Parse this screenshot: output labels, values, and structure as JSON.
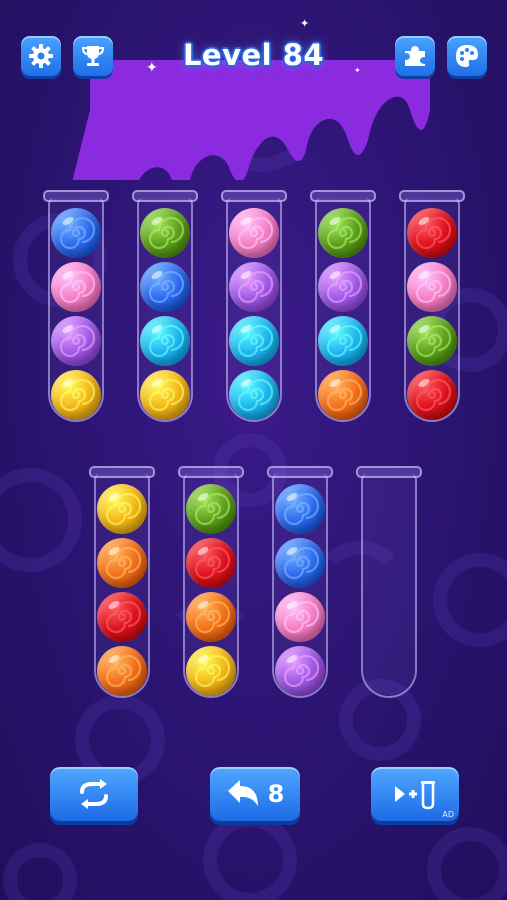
{
  "header": {
    "title": "Level 84"
  },
  "colors": {
    "blue": "#2f6cf0",
    "green": "#5fa11c",
    "pink": "#f77fc4",
    "purple": "#a05ae8",
    "cyan": "#1fb6f0",
    "yellow": "#f5b81a",
    "orange": "#f5701a",
    "red": "#e0141e"
  },
  "tubes": [
    {
      "balls": [
        "blue",
        "pink",
        "purple",
        "yellow"
      ]
    },
    {
      "balls": [
        "green",
        "blue",
        "cyan",
        "yellow"
      ]
    },
    {
      "balls": [
        "pink",
        "purple",
        "cyan",
        "cyan"
      ]
    },
    {
      "balls": [
        "green",
        "purple",
        "cyan",
        "orange"
      ]
    },
    {
      "balls": [
        "red",
        "pink",
        "green",
        "red"
      ]
    },
    {
      "balls": [
        "yellow",
        "orange",
        "red",
        "orange"
      ]
    },
    {
      "balls": [
        "green",
        "red",
        "orange",
        "yellow"
      ]
    },
    {
      "balls": [
        "blue",
        "blue",
        "pink",
        "purple"
      ]
    },
    {
      "balls": []
    }
  ],
  "controls": {
    "undo_count": "8",
    "ad_label": "AD"
  },
  "icons": {
    "settings": "gear-icon",
    "achievements": "trophy-icon",
    "puzzle": "puzzle-icon",
    "themes": "palette-icon",
    "restart": "restart-icon",
    "undo": "undo-icon",
    "add_tube": "add-tube-icon"
  }
}
